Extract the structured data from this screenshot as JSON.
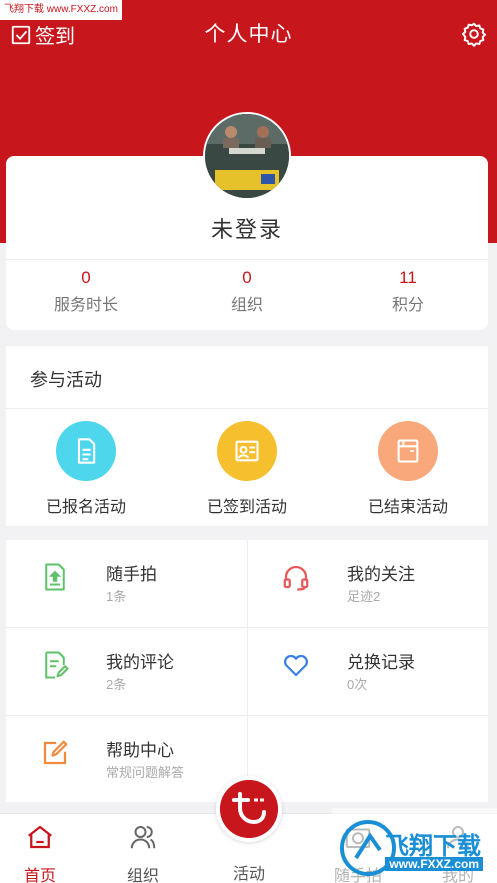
{
  "watermark_top": "飞翔下载 www.FXXZ.com",
  "header": {
    "checkin_label": "签到",
    "title": "个人中心"
  },
  "profile": {
    "name": "未登录",
    "stats": [
      {
        "value": "0",
        "label": "服务时长"
      },
      {
        "value": "0",
        "label": "组织"
      },
      {
        "value": "11",
        "label": "积分"
      }
    ]
  },
  "activity": {
    "title": "参与活动",
    "items": [
      {
        "label": "已报名活动",
        "color": "#4dd6ec",
        "icon": "document-icon"
      },
      {
        "label": "已签到活动",
        "color": "#f6bf2d",
        "icon": "signin-card-icon"
      },
      {
        "label": "已结束活动",
        "color": "#f8a87a",
        "icon": "folder-icon"
      }
    ]
  },
  "menu": [
    {
      "title": "随手拍",
      "sub": "1条",
      "icon": "upload-doc-icon"
    },
    {
      "title": "我的关注",
      "sub": "足迹2",
      "icon": "headset-icon"
    },
    {
      "title": "我的评论",
      "sub": "2条",
      "icon": "edit-doc-icon"
    },
    {
      "title": "兑换记录",
      "sub": "0次",
      "icon": "heart-icon"
    },
    {
      "title": "帮助中心",
      "sub": "常规问题解答",
      "icon": "pencil-square-icon"
    }
  ],
  "tabbar": {
    "tabs": [
      "首页",
      "组织",
      "活动",
      "随手拍",
      "我的"
    ],
    "active": "首页"
  },
  "watermark_bottom": {
    "text": "飞翔下载",
    "url": "www.FXXZ.com"
  },
  "colors": {
    "brand_red": "#c8161d",
    "watermark_blue": "#1a8fd6"
  }
}
